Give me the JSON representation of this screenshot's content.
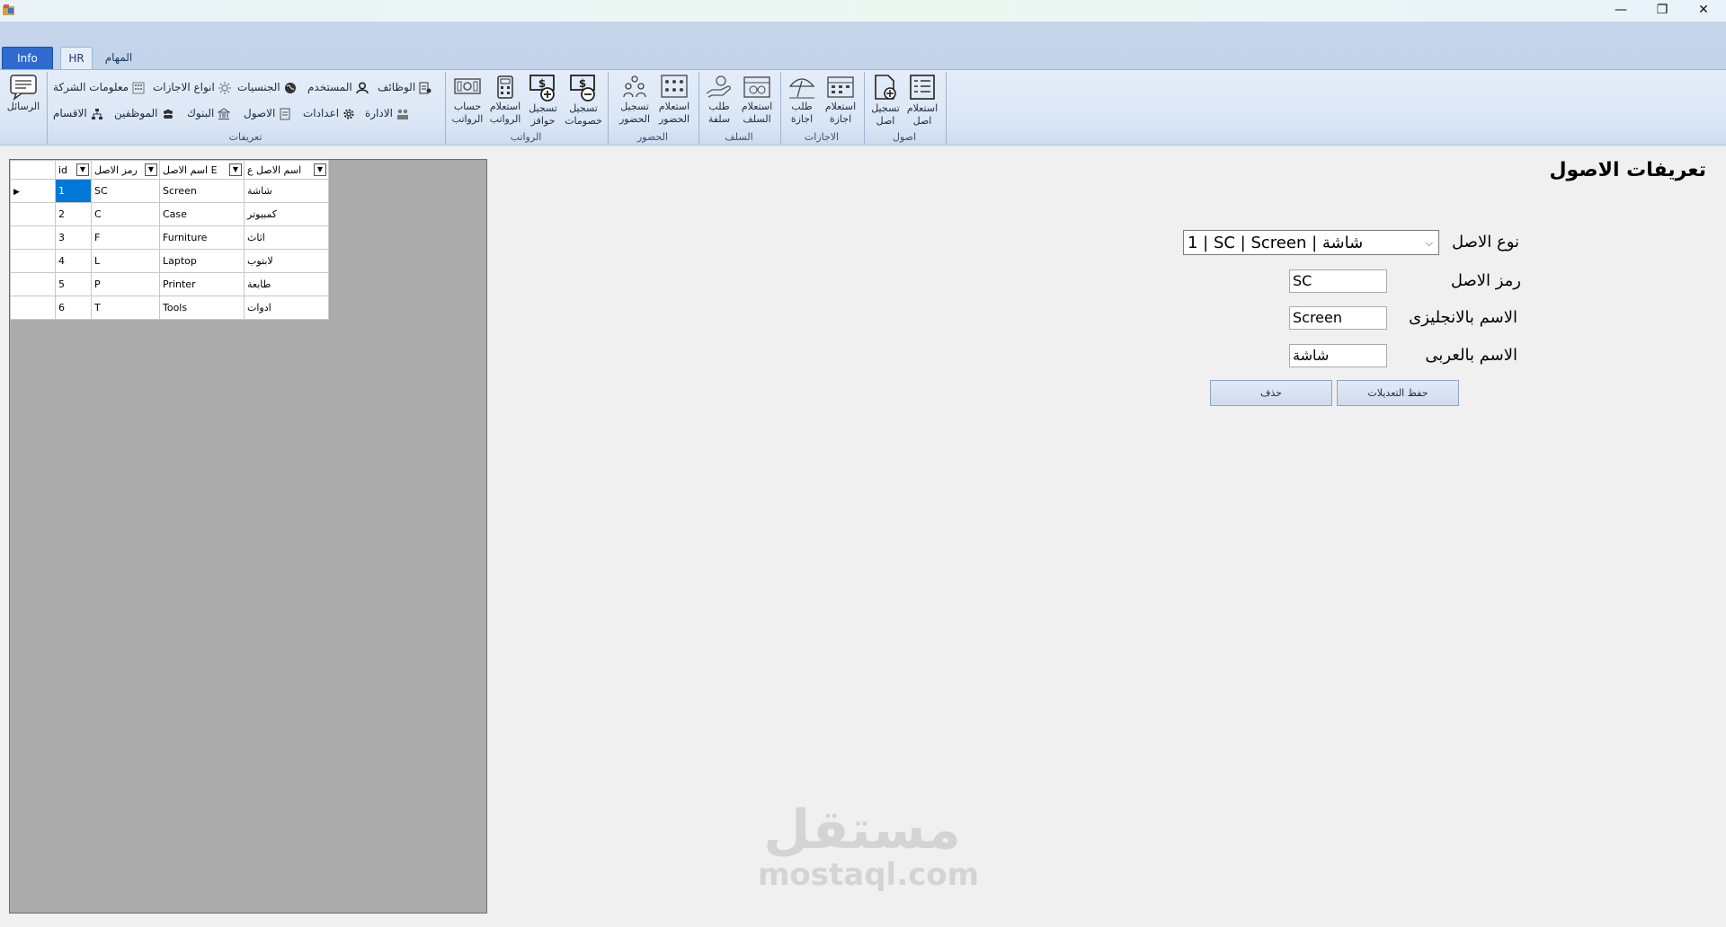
{
  "window": {
    "minimize_icon": "minimize-icon",
    "maximize_icon": "restore-icon",
    "close_icon": "close-icon",
    "minimize": "—",
    "restore": "❐",
    "close": "✕"
  },
  "ribbon": {
    "tabs": [
      "Info",
      "HR",
      "المهام"
    ],
    "messages": "الرسائل",
    "definitions": {
      "label": "تعريفات",
      "row1": [
        "الوظائف",
        "المستخدم",
        "الجنسيات",
        "انواع الاجازات",
        "معلومات الشركة"
      ],
      "row2": [
        "الادارة",
        "اعدادات",
        "الاصول",
        "البنوك",
        "الموظفين",
        "الاقسام"
      ]
    },
    "salaries": {
      "label": "الرواتب",
      "buttons": [
        "حساب\nالرواتب",
        "استعلام\nالرواتب",
        "تسجيل\nحوافز",
        "تسجيل\nخصومات"
      ]
    },
    "attendance": {
      "label": "الحضور",
      "buttons": [
        "تسجيل\nالحضور",
        "استعلام\nالحضور"
      ]
    },
    "advances": {
      "label": "السلف",
      "buttons": [
        "طلب\nسلفة",
        "استعلام\nالسلف"
      ]
    },
    "vacations": {
      "label": "الاجازات",
      "buttons": [
        "طلب\nاجازة",
        "استعلام\nاجازة"
      ]
    },
    "assets": {
      "label": "اصول",
      "buttons": [
        "تسجيل\nاصل",
        "استعلام\nاصل"
      ]
    }
  },
  "grid": {
    "columns": [
      "id",
      "رمز الاصل",
      "اسم الاصل E",
      "اسم الاصل ع"
    ],
    "rows": [
      [
        "1",
        "SC",
        "Screen",
        "شاشة"
      ],
      [
        "2",
        "C",
        "Case",
        "كمبيوتر"
      ],
      [
        "3",
        "F",
        "Furniture",
        "اثاث"
      ],
      [
        "4",
        "L",
        "Laptop",
        "لابتوب"
      ],
      [
        "5",
        "P",
        "Printer",
        "طابعة"
      ],
      [
        "6",
        "T",
        "Tools",
        "ادوات"
      ]
    ],
    "selected_row": 1
  },
  "form": {
    "title": "تعريفات الاصول",
    "asset_type_label": "نوع الاصل",
    "asset_type_value": "1 | SC | Screen | شاشة",
    "asset_code_label": "رمز الاصل",
    "asset_code_value": "SC",
    "name_en_label": "الاسم بالانجليزى",
    "name_en_value": "Screen",
    "name_ar_label": "الاسم بالعربى",
    "name_ar_value": "شاشة",
    "save_label": "حفظ التعديلات",
    "delete_label": "حذف"
  },
  "watermark": {
    "arabic": "مستقل",
    "latin": "mostaql.com"
  }
}
